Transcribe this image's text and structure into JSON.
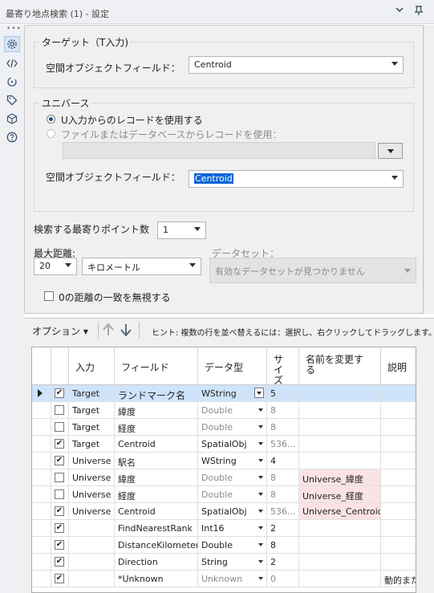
{
  "window": {
    "title": "最寄り地点検索 (1) - 設定"
  },
  "target_group": {
    "title": "ターゲット（T入力)",
    "field_label": "空間オブジェクトフィールド：",
    "field_value": "Centroid"
  },
  "universe_group": {
    "title": "ユニバース",
    "radio_u": "U入力からのレコードを使用する",
    "radio_file": "ファイルまたはデータベースからレコードを使用：",
    "field_label": "空間オブジェクトフィールド：",
    "field_value": "Centroid"
  },
  "options": {
    "nearest_label": "検索する最寄りポイント数",
    "nearest_value": "1",
    "maxdist_label": "最大距離:",
    "maxdist_value": "20",
    "unit_value": "キロメートル",
    "dataset_label": "データセット：",
    "dataset_value": "有効なデータセットが見つかりません",
    "ignore_zero_label": "0の距離の一致を無視する"
  },
  "toolbar": {
    "options_label": "オプション ▾",
    "hint": "ヒント: 複数の行を並べ替えるには：選択し、右クリックしてドラッグします。"
  },
  "grid": {
    "headers": {
      "input": "入力",
      "field": "フィールド",
      "type": "データ型",
      "size": "サイズ",
      "rename": "名前を変更する",
      "desc": "説明"
    },
    "rows": [
      {
        "check": "✔",
        "input": "Target",
        "field": "ランドマーク名",
        "type": "WString",
        "size": "5",
        "rename": "",
        "desc": ""
      },
      {
        "check": "",
        "input": "Target",
        "field": "緯度",
        "type": "Double",
        "size": "8",
        "rename": "",
        "desc": ""
      },
      {
        "check": "",
        "input": "Target",
        "field": "経度",
        "type": "Double",
        "size": "8",
        "rename": "",
        "desc": ""
      },
      {
        "check": "✔",
        "input": "Target",
        "field": "Centroid",
        "type": "SpatialObj",
        "size": "536...",
        "rename": "",
        "desc": ""
      },
      {
        "check": "✔",
        "input": "Universe",
        "field": "駅名",
        "type": "WString",
        "size": "4",
        "rename": "",
        "desc": ""
      },
      {
        "check": "",
        "input": "Universe",
        "field": "緯度",
        "type": "Double",
        "size": "8",
        "rename": "Universe_緯度",
        "desc": ""
      },
      {
        "check": "",
        "input": "Universe",
        "field": "経度",
        "type": "Double",
        "size": "8",
        "rename": "Universe_経度",
        "desc": ""
      },
      {
        "check": "✔",
        "input": "Universe",
        "field": "Centroid",
        "type": "SpatialObj",
        "size": "536...",
        "rename": "Universe_Centroid",
        "desc": ""
      },
      {
        "check": "✔",
        "input": "",
        "field": "FindNearestRank",
        "type": "Int16",
        "size": "2",
        "rename": "",
        "desc": ""
      },
      {
        "check": "✔",
        "input": "",
        "field": "DistanceKilometers",
        "type": "Double",
        "size": "8",
        "rename": "",
        "desc": ""
      },
      {
        "check": "✔",
        "input": "",
        "field": "Direction",
        "type": "String",
        "size": "2",
        "rename": "",
        "desc": ""
      },
      {
        "check": "✔",
        "input": "",
        "field": "*Unknown",
        "type": "Unknown",
        "size": "0",
        "rename": "",
        "desc": "動的また"
      }
    ]
  }
}
